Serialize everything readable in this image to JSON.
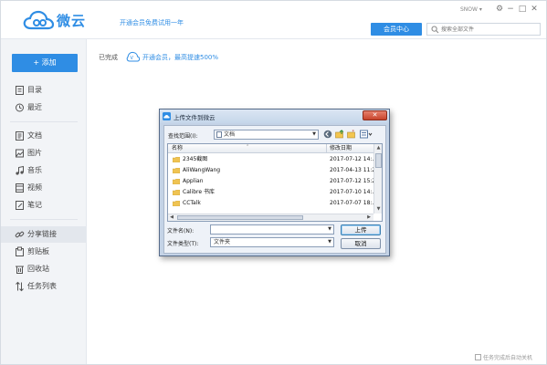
{
  "header": {
    "app_name": "微云",
    "promo": "开通会员免费试用一年",
    "user": "SNOW ▾",
    "vip_button": "会员中心",
    "search_placeholder": "搜索全部文件"
  },
  "sidebar": {
    "add_button": "+ 添加",
    "items": [
      {
        "label": "目录"
      },
      {
        "label": "最近"
      },
      {
        "label": "文档"
      },
      {
        "label": "图片"
      },
      {
        "label": "音乐"
      },
      {
        "label": "视频"
      },
      {
        "label": "笔记"
      },
      {
        "label": "分享链接"
      },
      {
        "label": "剪贴板"
      },
      {
        "label": "回收站"
      },
      {
        "label": "任务列表"
      }
    ]
  },
  "main": {
    "toolbar_label": "已完成",
    "boost_text": "开通会员，最高提速500%"
  },
  "status_bar": {
    "label": "任务完成后自动关机"
  },
  "dialog": {
    "title": "上传文件到微云",
    "close": "✕",
    "look_in_label": "查找范围(I):",
    "look_in_value": "文档",
    "columns": {
      "name": "名称",
      "date": "修改日期"
    },
    "files": [
      {
        "name": "2345截图",
        "date": "2017-07-12 14:..."
      },
      {
        "name": "AliWangWang",
        "date": "2017-04-13 11:2..."
      },
      {
        "name": "Applian",
        "date": "2017-07-12 15:2..."
      },
      {
        "name": "Calibre 书库",
        "date": "2017-07-10 14:..."
      },
      {
        "name": "CCTalk",
        "date": "2017-07-07 18:..."
      }
    ],
    "filename_label": "文件名(N):",
    "filename_value": "",
    "filetype_label": "文件类型(T):",
    "filetype_value": "文件夹",
    "upload_button": "上传",
    "cancel_button": "取消"
  }
}
